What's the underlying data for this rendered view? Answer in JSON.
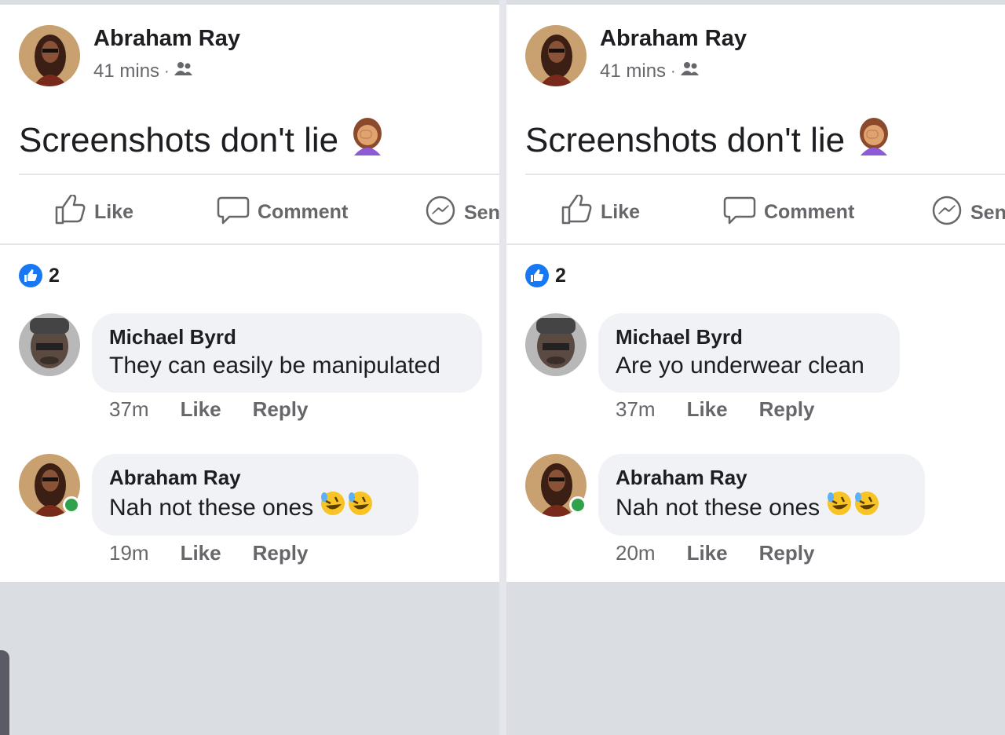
{
  "panels": [
    {
      "post": {
        "author": "Abraham Ray",
        "time": "41 mins",
        "separator": "·",
        "audience_icon": "friends-icon",
        "text": "Screenshots don't lie",
        "emoji": "woman-facepalming-emoji"
      },
      "actions": {
        "like": "Like",
        "comment": "Comment",
        "send": "Sen"
      },
      "reactions": {
        "icon": "like-reaction-icon",
        "count": "2"
      },
      "comments": [
        {
          "author": "Michael Byrd",
          "text": "They can easily be manipulated",
          "time": "37m",
          "like": "Like",
          "reply": "Reply"
        },
        {
          "author": "Abraham Ray",
          "text": "Nah not these ones",
          "emoji": "rolling-on-floor-laughing-emoji",
          "time": "19m",
          "like": "Like",
          "reply": "Reply"
        }
      ]
    },
    {
      "post": {
        "author": "Abraham Ray",
        "time": "41 mins",
        "separator": "·",
        "audience_icon": "friends-icon",
        "text": "Screenshots don't lie",
        "emoji": "woman-facepalming-emoji"
      },
      "actions": {
        "like": "Like",
        "comment": "Comment",
        "send": "Sen"
      },
      "reactions": {
        "icon": "like-reaction-icon",
        "count": "2"
      },
      "comments": [
        {
          "author": "Michael Byrd",
          "text": "Are yo underwear clean",
          "time": "37m",
          "like": "Like",
          "reply": "Reply"
        },
        {
          "author": "Abraham Ray",
          "text": "Nah not these ones",
          "emoji": "rolling-on-floor-laughing-emoji",
          "time": "20m",
          "like": "Like",
          "reply": "Reply"
        }
      ]
    }
  ],
  "colors": {
    "accent": "#1877f2",
    "online": "#31a24c",
    "muted": "#65676b",
    "bubble": "#f0f2f5"
  }
}
